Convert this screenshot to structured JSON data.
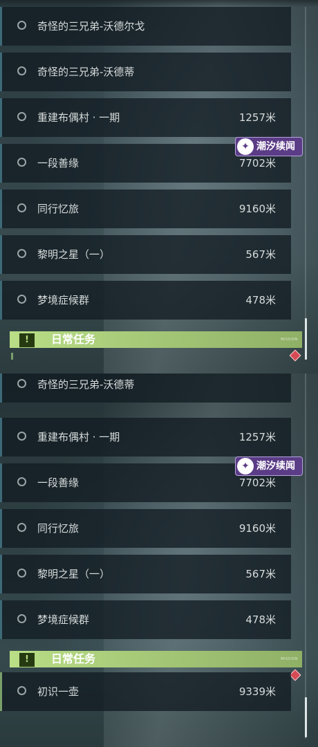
{
  "panel1": {
    "quests": [
      {
        "name": "奇怪的三兄弟-沃德尔戈",
        "distance": ""
      },
      {
        "name": "奇怪的三兄弟-沃德蒂",
        "distance": ""
      },
      {
        "name": "重建布偶村 · 一期",
        "distance": "1257米"
      },
      {
        "name": "一段善缘",
        "distance": "7702米"
      },
      {
        "name": "同行忆旅",
        "distance": "9160米"
      },
      {
        "name": "黎明之星（一）",
        "distance": "567米"
      },
      {
        "name": "梦境症候群",
        "distance": "478米"
      }
    ],
    "badge": {
      "label": "潮汐续闻",
      "icon": "tide-logo-icon"
    },
    "section": {
      "title": "日常任务",
      "icon_text": "!",
      "deco_text": "MISSION"
    }
  },
  "panel2": {
    "quests": [
      {
        "name": "奇怪的三兄弟-沃德蒂",
        "distance": ""
      },
      {
        "name": "重建布偶村 · 一期",
        "distance": "1257米"
      },
      {
        "name": "一段善缘",
        "distance": "7702米"
      },
      {
        "name": "同行忆旅",
        "distance": "9160米"
      },
      {
        "name": "黎明之星（一）",
        "distance": "567米"
      },
      {
        "name": "梦境症候群",
        "distance": "478米"
      }
    ],
    "badge": {
      "label": "潮汐续闻",
      "icon": "tide-logo-icon"
    },
    "section": {
      "title": "日常任务",
      "icon_text": "!",
      "deco_text": "MISSION"
    },
    "daily": [
      {
        "name": "初识一壶",
        "distance": "9339米"
      }
    ]
  },
  "colors": {
    "accent_green": "#b9de86",
    "badge_purple": "#5b3c86",
    "marker_red": "#d64a55",
    "row_edge_blue": "#3e6a78"
  }
}
